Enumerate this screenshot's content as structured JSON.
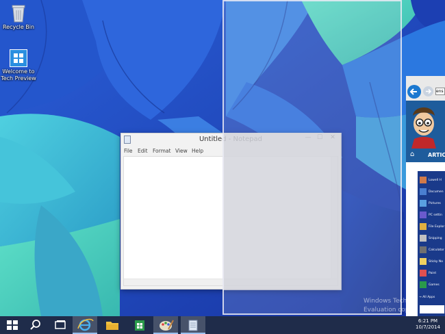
{
  "desktop": {
    "icons": [
      {
        "label": "Recycle Bin",
        "icon": "recycle-bin-icon"
      },
      {
        "label": "Welcome to\nTech Preview",
        "icon": "windows-logo-icon"
      }
    ]
  },
  "notepad": {
    "title": "Untitled - Notepad",
    "menu": [
      "File",
      "Edit",
      "Format",
      "View",
      "Help"
    ],
    "controls": {
      "minimize": "—",
      "maximize": "☐",
      "close": "✕"
    },
    "content": ""
  },
  "browser": {
    "address": "ens",
    "banner_text": "ARTIC",
    "start_items": [
      {
        "label": "Lowell H",
        "icon": "user-icon",
        "color": "#d07a4a"
      },
      {
        "label": "Documen",
        "icon": "documents-icon",
        "color": "#4a7fd0"
      },
      {
        "label": "Pictures",
        "icon": "pictures-icon",
        "color": "#5aa0e0"
      },
      {
        "label": "PC settin",
        "icon": "gear-icon",
        "color": "#6a5acd"
      },
      {
        "label": "File Explor",
        "icon": "folder-icon",
        "color": "#e0b040"
      },
      {
        "label": "Snipping",
        "icon": "scissors-icon",
        "color": "#c0c0c0"
      },
      {
        "label": "Calculator",
        "icon": "calculator-icon",
        "color": "#707070"
      },
      {
        "label": "Sticky No",
        "icon": "note-icon",
        "color": "#f0d060"
      },
      {
        "label": "Paint",
        "icon": "paint-icon",
        "color": "#e05050"
      },
      {
        "label": "Games",
        "icon": "gamepad-icon",
        "color": "#2a9a4a"
      }
    ],
    "all_apps": "All Apps",
    "search_placeholder": ""
  },
  "watermark": {
    "line1": "Windows Tech",
    "line2": "Evaluation cop"
  },
  "taskbar": {
    "buttons": [
      {
        "name": "start-button",
        "icon": "windows-logo-icon"
      },
      {
        "name": "search-button",
        "icon": "search-icon"
      },
      {
        "name": "task-view-button",
        "icon": "task-view-icon"
      },
      {
        "name": "internet-explorer-button",
        "icon": "ie-icon"
      },
      {
        "name": "file-explorer-button",
        "icon": "folder-icon"
      },
      {
        "name": "store-button",
        "icon": "store-icon"
      },
      {
        "name": "paint-button",
        "icon": "paint-icon"
      },
      {
        "name": "notepad-button",
        "icon": "notepad-icon"
      }
    ],
    "time": "6:21 PM",
    "date": "10/7/2014"
  },
  "colors": {
    "taskbar": "#1f2c4a",
    "wallpaper_blue": "#1f3fae",
    "wallpaper_teal": "#3cc4d6",
    "accent": "#1e5c9c"
  }
}
